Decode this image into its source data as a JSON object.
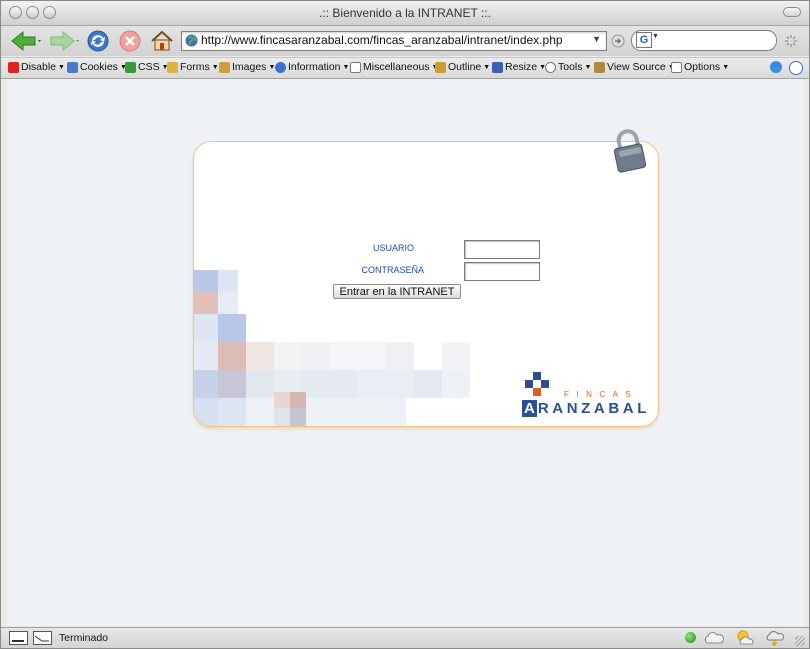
{
  "window": {
    "title": ".:: Bienvenido a la INTRANET ::."
  },
  "navbar": {
    "url": "http://www.fincasaranzabal.com/fincas_aranzabal/intranet/index.php"
  },
  "devbar": {
    "items": [
      {
        "label": "Disable",
        "icon": "disable-icon",
        "color": "#d22"
      },
      {
        "label": "Cookies",
        "icon": "cookies-icon",
        "color": "#4a7bc7"
      },
      {
        "label": "CSS",
        "icon": "css-icon",
        "color": "#3a9a3a"
      },
      {
        "label": "Forms",
        "icon": "forms-icon",
        "color": "#e0b040"
      },
      {
        "label": "Images",
        "icon": "images-icon",
        "color": "#caa040"
      },
      {
        "label": "Information",
        "icon": "information-icon",
        "color": "#3b6fd0"
      },
      {
        "label": "Miscellaneous",
        "icon": "miscellaneous-icon",
        "color": "#777"
      },
      {
        "label": "Outline",
        "icon": "outline-icon",
        "color": "#c9a030"
      },
      {
        "label": "Resize",
        "icon": "resize-icon",
        "color": "#3a5fb0"
      },
      {
        "label": "Tools",
        "icon": "tools-icon",
        "color": "#888"
      },
      {
        "label": "View Source",
        "icon": "view-source-icon",
        "color": "#b08a40"
      },
      {
        "label": "Options",
        "icon": "options-icon",
        "color": "#777"
      }
    ]
  },
  "login": {
    "user_label": "USUARIO",
    "password_label": "CONTRASEÑA",
    "user_value": "",
    "password_value": "",
    "submit_label": "Entrar en la INTRANET"
  },
  "logo": {
    "top_word": "FINCAS",
    "name_first": "A",
    "name_rest": "RANZABAL"
  },
  "statusbar": {
    "text": "Terminado"
  },
  "colors": {
    "accent_label": "#1f49a6",
    "panel_border": "#f2c48a",
    "logo_blue": "#2c4e97",
    "logo_orange": "#e0601a"
  }
}
